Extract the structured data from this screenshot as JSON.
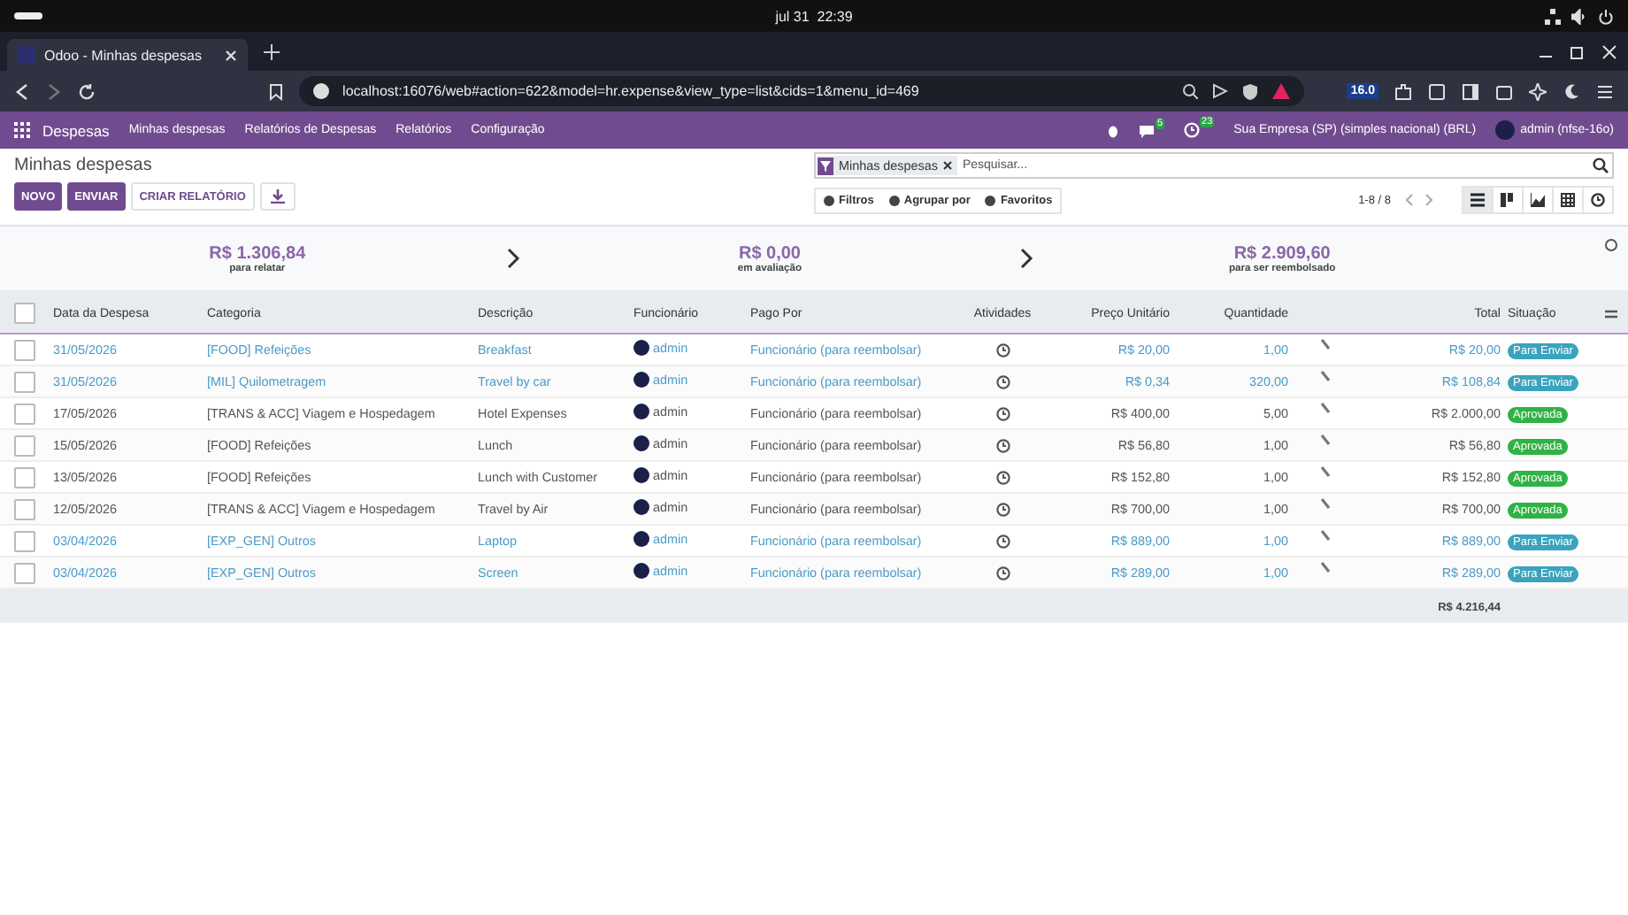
{
  "os_bar": {
    "clock": "jul 31  22:39"
  },
  "browser": {
    "tab_title": "Odoo - Minhas despesas",
    "url": "localhost:16076/web#action=622&model=hr.expense&view_type=list&cids=1&menu_id=469",
    "version_badge": "16.0"
  },
  "app_nav": {
    "app_name": "Despesas",
    "menu": [
      "Minhas despesas",
      "Relatórios de Despesas",
      "Relatórios",
      "Configuração"
    ],
    "messages_count": "5",
    "activities_count": "23",
    "company": "Sua Empresa (SP) (simples nacional) (BRL)",
    "user": "admin (nfse-16o)"
  },
  "control_panel": {
    "title": "Minhas despesas",
    "buttons": [
      "NOVO",
      "ENVIAR"
    ],
    "report_button": "CRIAR RELATÓRIO",
    "facet": "Minhas despesas",
    "search_placeholder": "Pesquisar...",
    "filters": [
      "Filtros",
      "Agrupar por",
      "Favoritos"
    ],
    "pager": "1-8 / 8",
    "views": [
      {
        "kind": "list",
        "selected": true
      },
      {
        "kind": "kanban",
        "selected": false
      },
      {
        "kind": "graph",
        "selected": false
      },
      {
        "kind": "pivot",
        "selected": false
      },
      {
        "kind": "activity",
        "selected": false
      }
    ]
  },
  "summary": [
    {
      "amount": "R$ 1.306,84",
      "label": "para relatar"
    },
    {
      "amount": "R$ 0,00",
      "label": "em avaliação"
    },
    {
      "amount": "R$ 2.909,60",
      "label": "para ser reembolsado"
    }
  ],
  "table": {
    "columns": [
      "Data da Despesa",
      "Categoria",
      "Descrição",
      "Funcionário",
      "Pago Por",
      "Atividades",
      "Preço Unitário",
      "Quantidade",
      "Total",
      "Situação"
    ],
    "select_all_checked": false,
    "rows": [
      {
        "kind": "draft",
        "checked": false,
        "date": "31/05/2026",
        "category": "[FOOD] Refeições",
        "description": "Breakfast",
        "employee": "admin",
        "paid_by": "Funcionário (para reembolsar)",
        "unit_price": "R$ 20,00",
        "quantity": "1,00",
        "total": "R$ 20,00",
        "status": "Para Enviar",
        "color": "#3ba3bd"
      },
      {
        "kind": "draft",
        "checked": false,
        "date": "31/05/2026",
        "category": "[MIL] Quilometragem",
        "description": "Travel by car",
        "employee": "admin",
        "paid_by": "Funcionário (para reembolsar)",
        "unit_price": "R$ 0,34",
        "quantity": "320,00",
        "total": "R$ 108,84",
        "status": "Para Enviar",
        "color": "#3ba3bd"
      },
      {
        "kind": "approved",
        "checked": false,
        "date": "17/05/2026",
        "category": "[TRANS & ACC] Viagem e Hospedagem",
        "description": "Hotel Expenses",
        "employee": "admin",
        "paid_by": "Funcionário (para reembolsar)",
        "unit_price": "R$ 400,00",
        "quantity": "5,00",
        "total": "R$ 2.000,00",
        "status": "Aprovada",
        "color": "#2fb344"
      },
      {
        "kind": "approved",
        "checked": false,
        "date": "15/05/2026",
        "category": "[FOOD] Refeições",
        "description": "Lunch",
        "employee": "admin",
        "paid_by": "Funcionário (para reembolsar)",
        "unit_price": "R$ 56,80",
        "quantity": "1,00",
        "total": "R$ 56,80",
        "status": "Aprovada",
        "color": "#2fb344"
      },
      {
        "kind": "approved",
        "checked": false,
        "date": "13/05/2026",
        "category": "[FOOD] Refeições",
        "description": "Lunch with Customer",
        "employee": "admin",
        "paid_by": "Funcionário (para reembolsar)",
        "unit_price": "R$ 152,80",
        "quantity": "1,00",
        "total": "R$ 152,80",
        "status": "Aprovada",
        "color": "#2fb344"
      },
      {
        "kind": "approved",
        "checked": false,
        "date": "12/05/2026",
        "category": "[TRANS & ACC] Viagem e Hospedagem",
        "description": "Travel by Air",
        "employee": "admin",
        "paid_by": "Funcionário (para reembolsar)",
        "unit_price": "R$ 700,00",
        "quantity": "1,00",
        "total": "R$ 700,00",
        "status": "Aprovada",
        "color": "#2fb344"
      },
      {
        "kind": "draft",
        "checked": false,
        "date": "03/04/2026",
        "category": "[EXP_GEN] Outros",
        "description": "Laptop",
        "employee": "admin",
        "paid_by": "Funcionário (para reembolsar)",
        "unit_price": "R$ 889,00",
        "quantity": "1,00",
        "total": "R$ 889,00",
        "status": "Para Enviar",
        "color": "#3ba3bd"
      },
      {
        "kind": "draft",
        "checked": false,
        "date": "03/04/2026",
        "category": "[EXP_GEN] Outros",
        "description": "Screen",
        "employee": "admin",
        "paid_by": "Funcionário (para reembolsar)",
        "unit_price": "R$ 289,00",
        "quantity": "1,00",
        "total": "R$ 289,00",
        "status": "Para Enviar",
        "color": "#3ba3bd"
      }
    ],
    "grand_total": "R$ 4.216,44"
  }
}
